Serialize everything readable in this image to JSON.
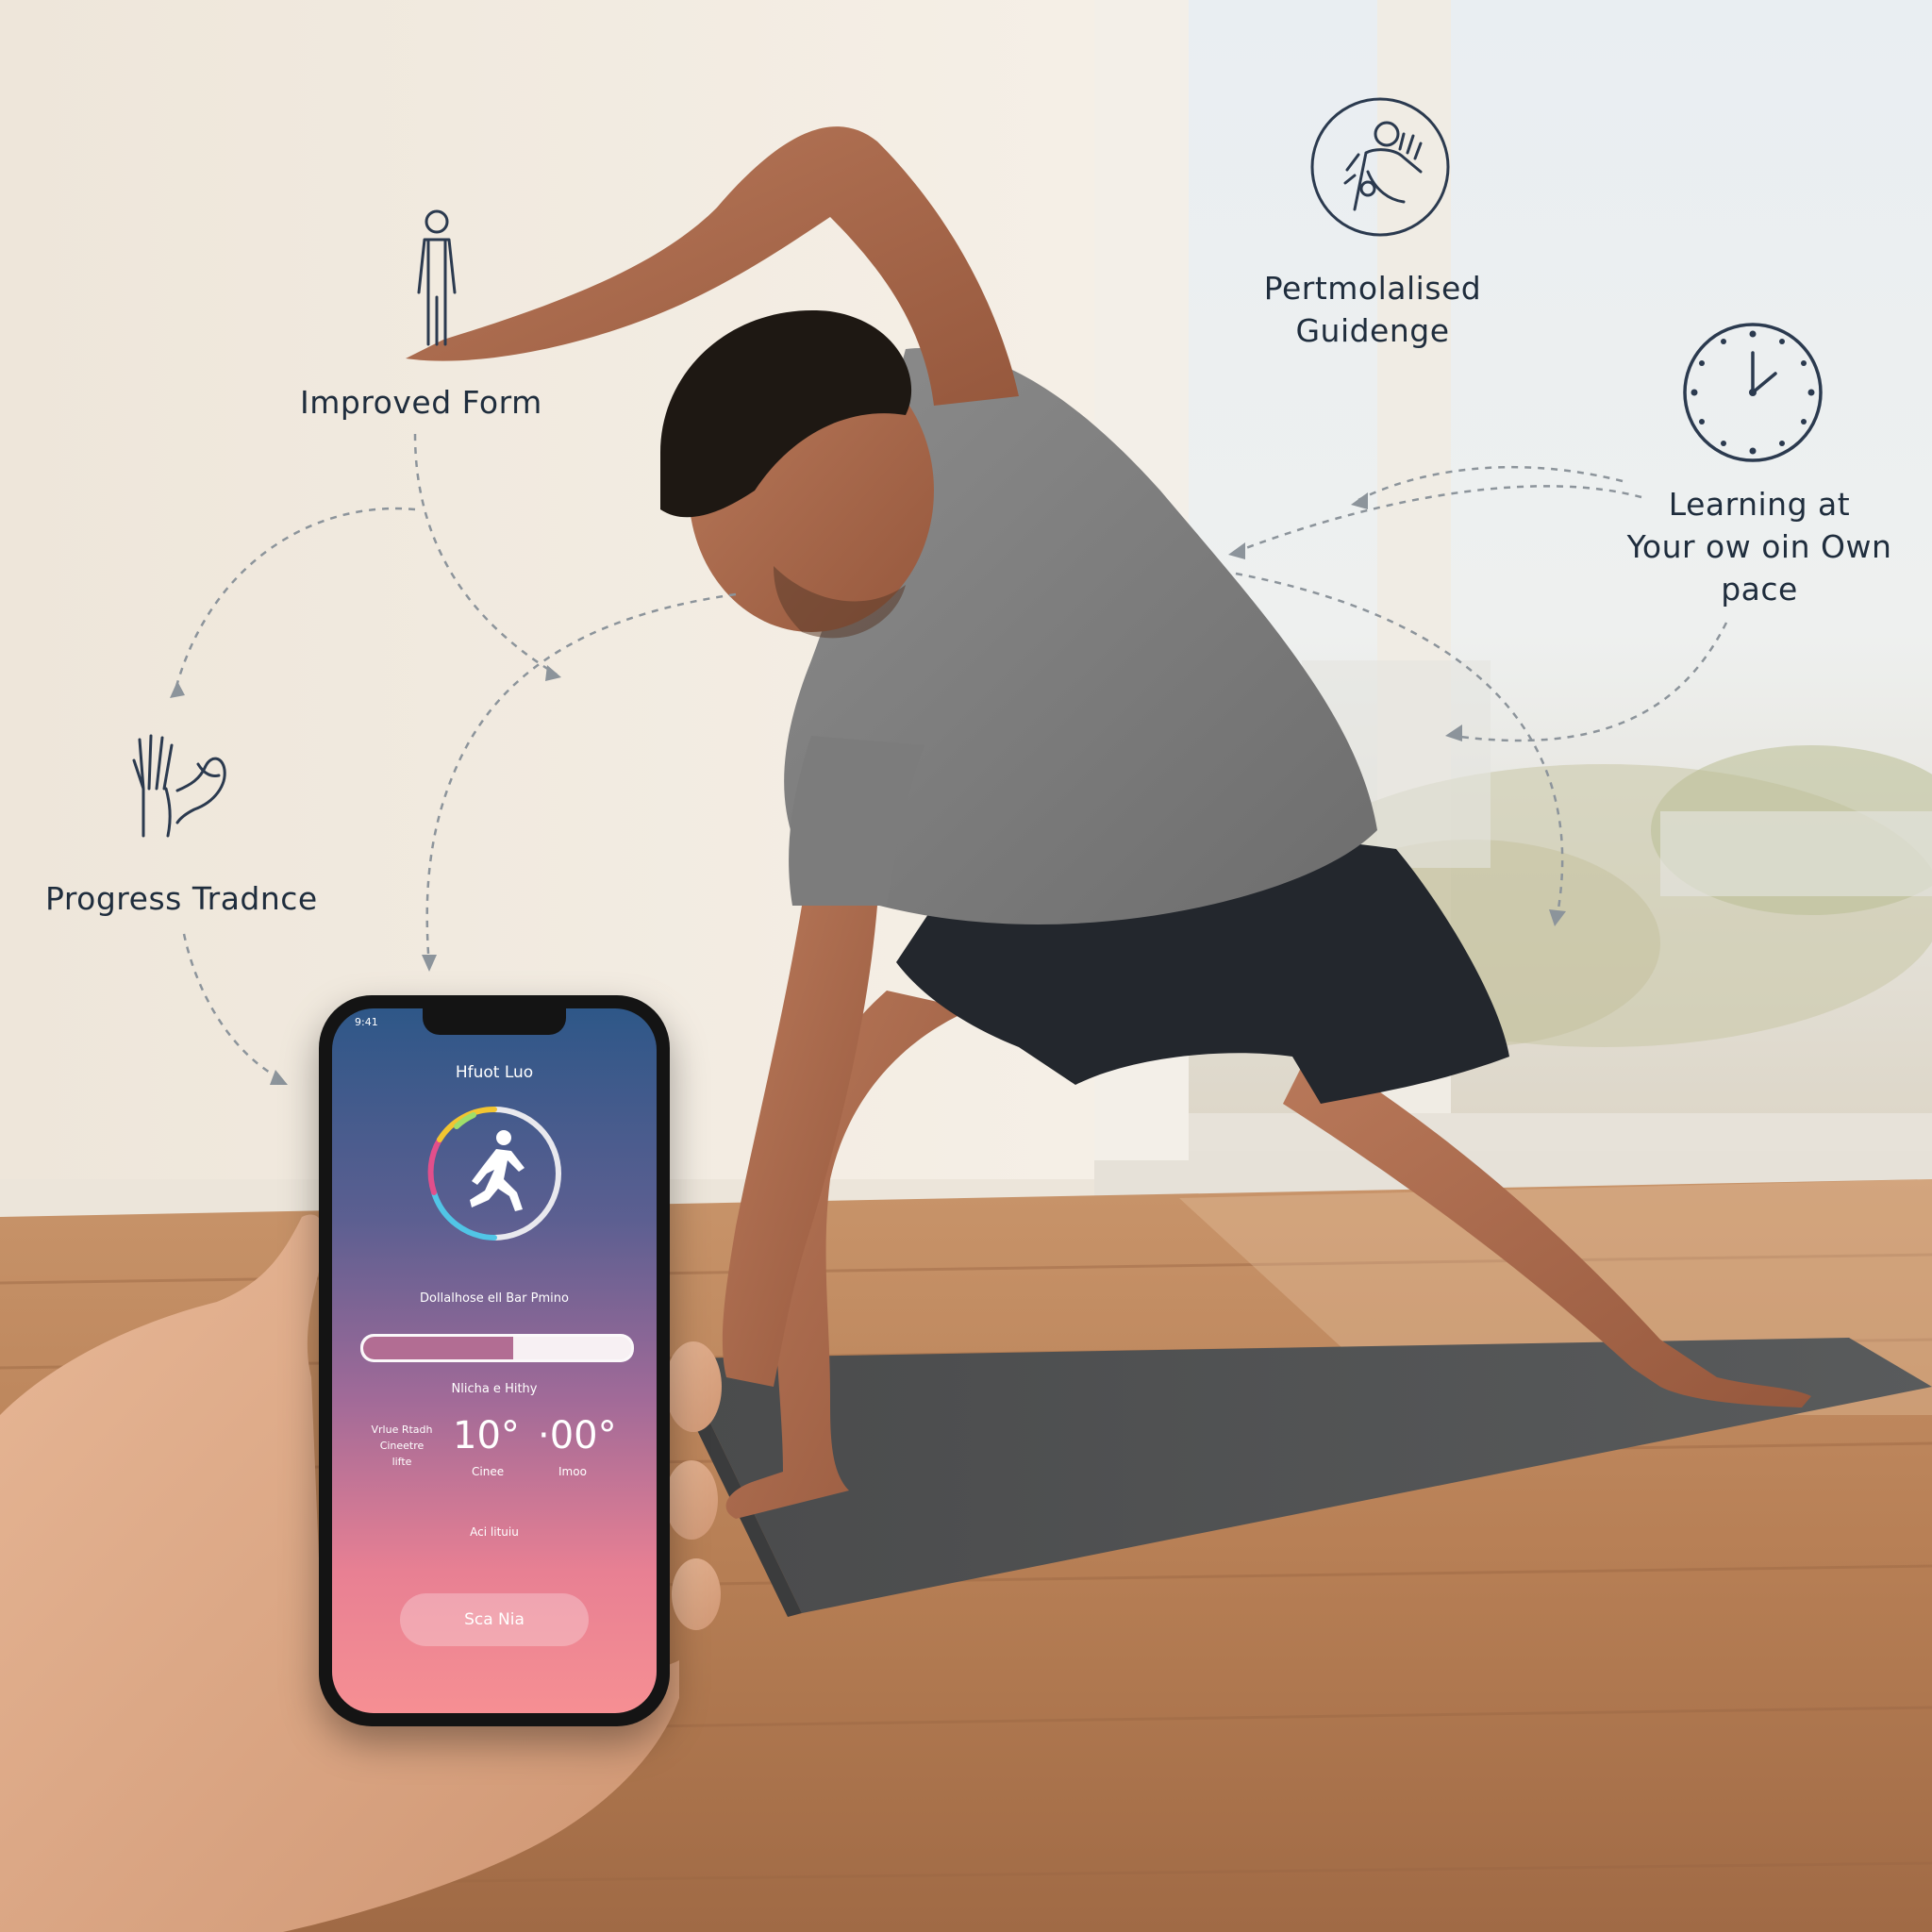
{
  "features": {
    "improved_form": "Improved Form",
    "personalised_guidance": [
      "Pertmolalised",
      "Guidenge"
    ],
    "learning_pace": [
      "Learning at",
      "Your ow oin Own",
      "pace"
    ],
    "progress_tracking": "Progress Tradnce"
  },
  "phone": {
    "status_time": "9:41",
    "app_title": "Hfuot Luo",
    "workout_name": "Dollalhose ell Bar Pmino",
    "progress_fraction": 0.56,
    "section_label": "Nlicha e Hithy",
    "stats": {
      "left_label_1": "Vrlue Rtadh",
      "left_label_2": "Cineetre",
      "left_label_3": "lifte",
      "value_1": "10°",
      "unit_1": "Cinee",
      "value_2": "·00°",
      "unit_2": "Imoo"
    },
    "footer_label": "Aci lituiu",
    "start_label": "Sca Nia"
  },
  "colors": {
    "icon_stroke": "#2b3a4f",
    "screen_top": "#2e5788",
    "screen_bottom": "#f68f93",
    "ring_colors": [
      "#f2c531",
      "#51c5e6",
      "#e24f8b",
      "#9fdf6a"
    ]
  }
}
